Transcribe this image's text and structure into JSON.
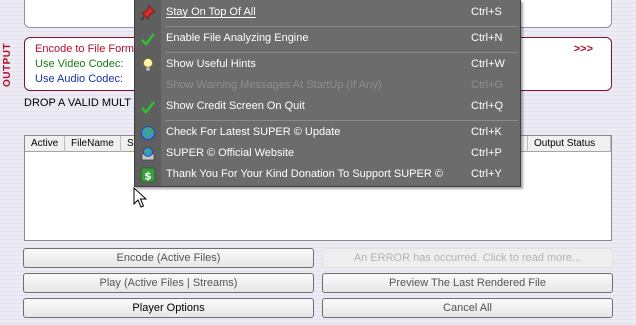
{
  "output": {
    "section_label": "OUTPUT",
    "encode_label": "Encode to File Forma",
    "video_codec_label": "Use Video Codec:",
    "audio_codec_label": "Use Audio Codec:",
    "chevrons": ">>>"
  },
  "drop_text": "DROP A VALID MULT",
  "table": {
    "headers": [
      "Active",
      "FileName",
      "S",
      "Output Status"
    ]
  },
  "menu": {
    "items": [
      {
        "label": "Stay On Top Of All",
        "shortcut": "Ctrl+S",
        "icon": "pushpin-icon",
        "enabled": true
      },
      {
        "label": "Enable File Analyzing Engine",
        "shortcut": "Ctrl+N",
        "icon": "checkmark-icon",
        "enabled": true
      },
      {
        "label": "Show Useful Hints",
        "shortcut": "Ctrl+W",
        "icon": "lightbulb-icon",
        "enabled": true
      },
      {
        "label": "Show Warning Messages At StartUp (If Any)",
        "shortcut": "Ctrl+G",
        "icon": "",
        "enabled": false
      },
      {
        "label": "Show Credit Screen On Quit",
        "shortcut": "Ctrl+Q",
        "icon": "checkmark-icon",
        "enabled": true
      },
      {
        "label": "Check For Latest SUPER © Update",
        "shortcut": "Ctrl+K",
        "icon": "globe-icon",
        "enabled": true
      },
      {
        "label": "SUPER © Official Website",
        "shortcut": "Ctrl+P",
        "icon": "computer-globe-icon",
        "enabled": true
      },
      {
        "label": "Thank You For Your Kind Donation To Support SUPER ©",
        "shortcut": "Ctrl+Y",
        "icon": "dollar-icon",
        "enabled": true
      }
    ]
  },
  "buttons": {
    "encode": "Encode (Active Files)",
    "error": "An ERROR has occurred. Click to read more...",
    "play": "Play (Active Files | Streams)",
    "preview": "Preview The Last Rendered File",
    "player_options": "Player Options",
    "cancel_all": "Cancel All"
  },
  "colors": {
    "menu_bg": "#6c6c6c",
    "output_red": "#b10d2a",
    "video_green": "#1b7a12",
    "audio_blue": "#1a2fa8"
  }
}
